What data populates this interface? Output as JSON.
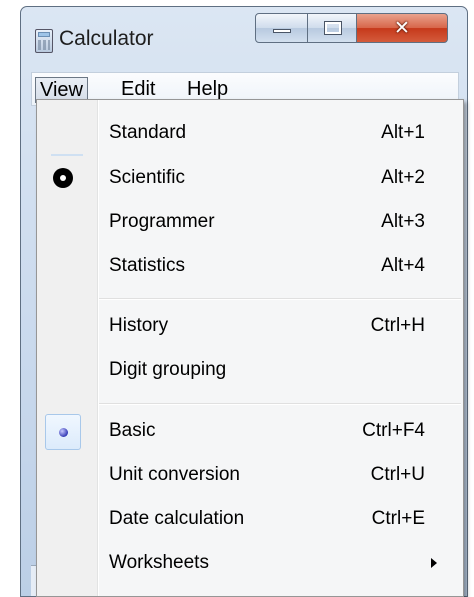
{
  "window": {
    "title": "Calculator"
  },
  "menubar": {
    "view": "View",
    "edit": "Edit",
    "help": "Help"
  },
  "view_menu": {
    "items": [
      {
        "label": "Standard",
        "shortcut": "Alt+1"
      },
      {
        "label": "Scientific",
        "shortcut": "Alt+2",
        "checked": true
      },
      {
        "label": "Programmer",
        "shortcut": "Alt+3"
      },
      {
        "label": "Statistics",
        "shortcut": "Alt+4"
      },
      {
        "label": "History",
        "shortcut": "Ctrl+H"
      },
      {
        "label": "Digit grouping",
        "shortcut": ""
      },
      {
        "label": "Basic",
        "shortcut": "Ctrl+F4",
        "selected": true
      },
      {
        "label": "Unit conversion",
        "shortcut": "Ctrl+U"
      },
      {
        "label": "Date calculation",
        "shortcut": "Ctrl+E"
      },
      {
        "label": "Worksheets",
        "shortcut": "",
        "submenu": true
      }
    ]
  },
  "colors": {
    "menu_bg": "#f5f6f7",
    "gutter_bg": "#f0f0f0",
    "close_red": "#c6391b",
    "radio_blue": "#353bb5"
  },
  "icons": {
    "app": "calculator-icon",
    "minimize": "minimize-icon",
    "maximize": "maximize-icon",
    "close": "close-icon",
    "submenu": "submenu-arrow-icon"
  }
}
